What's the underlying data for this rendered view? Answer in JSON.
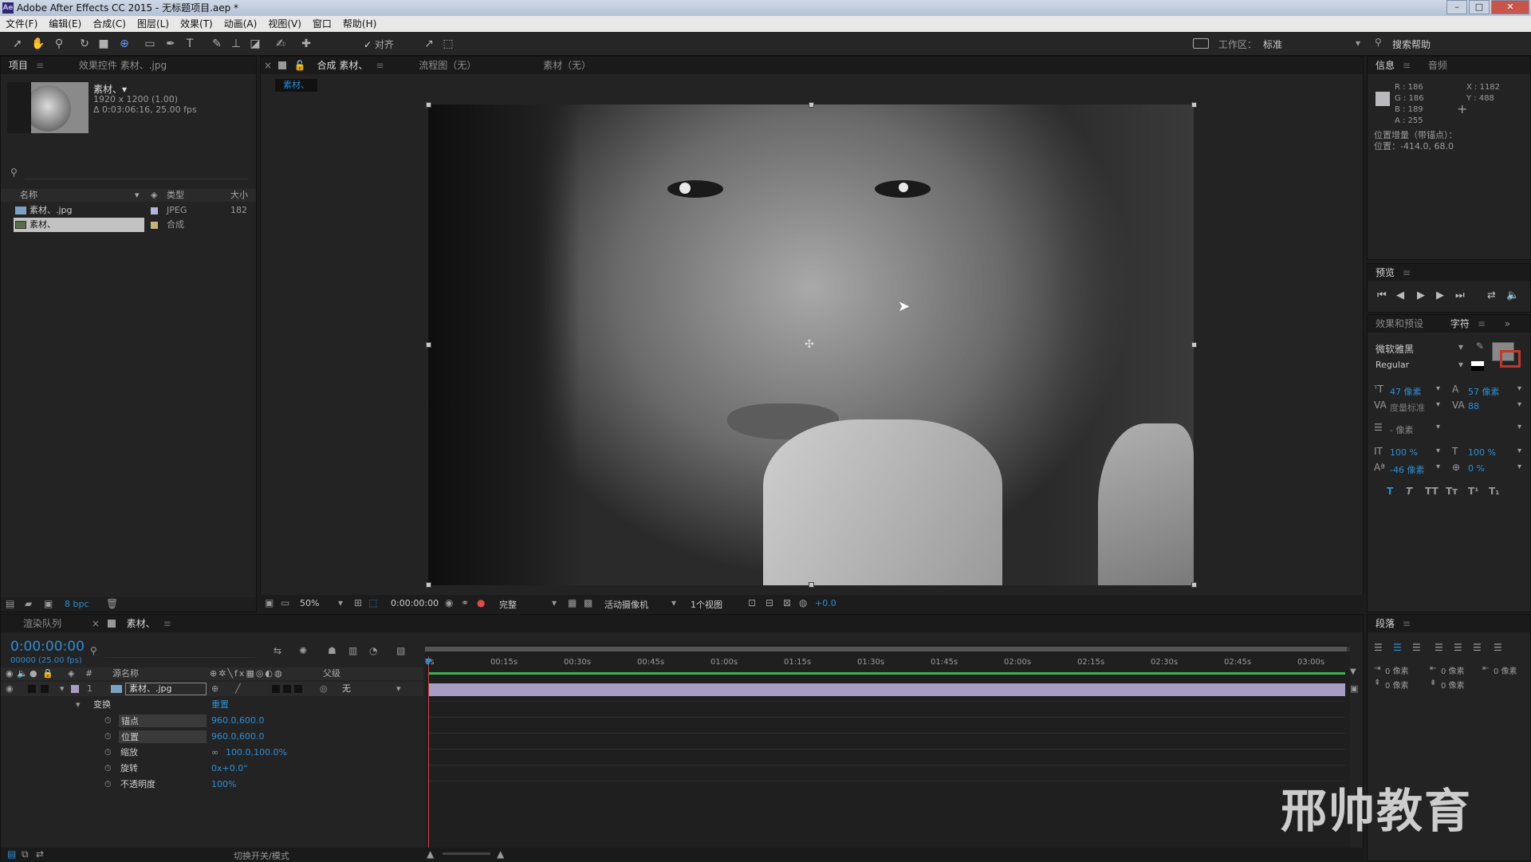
{
  "app": {
    "title": "Adobe After Effects CC 2015 - 无标题项目.aep *",
    "icon": "Ae"
  },
  "menu": [
    "文件(F)",
    "编辑(E)",
    "合成(C)",
    "图层(L)",
    "效果(T)",
    "动画(A)",
    "视图(V)",
    "窗口",
    "帮助(H)"
  ],
  "toolbar": {
    "snap_label": "对齐",
    "workspace_label": "工作区：",
    "workspace_value": "标准",
    "search_help": "搜索帮助"
  },
  "project_panel": {
    "tabs": [
      "项目",
      "效果控件 素材、.jpg"
    ],
    "item_name": "素材、▾",
    "item_dims": "1920 x 1200 (1.00)",
    "item_duration": "Δ 0:03:06:16, 25.00 fps",
    "columns": {
      "name": "名称",
      "type": "类型",
      "size": "大小"
    },
    "items": [
      {
        "name": "素材、.jpg",
        "type": "JPEG",
        "size": "182"
      },
      {
        "name": "素材、",
        "type": "合成",
        "size": ""
      }
    ],
    "bpc": "8 bpc"
  },
  "viewer": {
    "tabs": [
      "合成 素材、",
      "流程图（无）",
      "素材（无）"
    ],
    "comp_label": "素材、",
    "zoom": "50%",
    "timecode": "0:00:00:00",
    "resolution": "完整",
    "camera": "活动摄像机",
    "views": "1个视图",
    "exposure": "+0.0"
  },
  "info_panel": {
    "tabs": [
      "信息",
      "音频"
    ],
    "r": "R : 186",
    "g": "G : 186",
    "b": "B : 189",
    "a": "A : 255",
    "x": "X : 1182",
    "y": "Y : 488",
    "line1": "位置增量（带锚点）：",
    "line2": "位置：-414.0, 68.0",
    "swatch_color": "#bababd"
  },
  "preview_panel": {
    "title": "预览"
  },
  "char_panel": {
    "tabs": [
      "效果和预设",
      "字符"
    ],
    "font": "微软雅黑",
    "style": "Regular",
    "size": "47 像素",
    "leading": "57 像素",
    "kerning": "度量标准",
    "tracking": "88",
    "stroke": "- 像素",
    "vscale": "100 %",
    "hscale": "100 %",
    "baseline": "-46 像素",
    "tsume": "0 %",
    "styles": [
      "T",
      "T",
      "TT",
      "Tт",
      "T¹",
      "T₁"
    ]
  },
  "para_panel": {
    "title": "段落",
    "indent1": "0 像素",
    "indent2": "0 像素",
    "indent3": "0 像素",
    "space1": "0 像素",
    "space2": "0 像素"
  },
  "timeline": {
    "tabs": [
      "渲染队列",
      "素材、"
    ],
    "timecode": "0:00:00:00",
    "frame": "00000 (25.00 fps)",
    "col_source": "源名称",
    "col_parent": "父级",
    "layer": {
      "index": "1",
      "name": "素材、.jpg",
      "parent": "无"
    },
    "transform": {
      "label": "变换",
      "reset": "重置"
    },
    "props": [
      {
        "name": "锚点",
        "value": "960.0,600.0"
      },
      {
        "name": "位置",
        "value": "960.0,600.0"
      },
      {
        "name": "缩放",
        "value": "100.0,100.0%"
      },
      {
        "name": "旋转",
        "value": "0x+0.0°"
      },
      {
        "name": "不透明度",
        "value": "100%"
      }
    ],
    "ruler": [
      "0s",
      "00:15s",
      "00:30s",
      "00:45s",
      "01:00s",
      "01:15s",
      "01:30s",
      "01:45s",
      "02:00s",
      "02:15s",
      "02:30s",
      "02:45s",
      "03:00s"
    ],
    "toggle_mode": "切换开关/模式"
  },
  "watermark": "邢帅教育",
  "colors": {
    "accent": "#2b8fd6",
    "layer_bar": "#a69cc4",
    "work_area": "#41b04a"
  }
}
